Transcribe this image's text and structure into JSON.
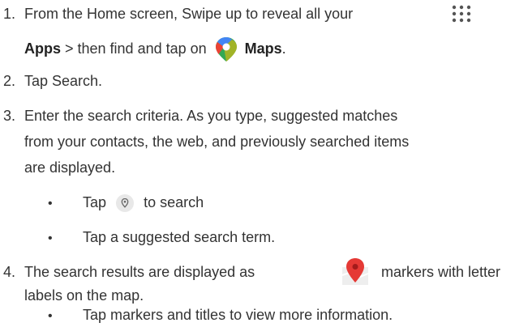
{
  "steps": [
    {
      "number": "1.",
      "line1": "From the Home screen, Swipe up to reveal all your",
      "apps_label": "Apps",
      "sep": " > then find and tap on ",
      "maps_label": "Maps",
      "end": "."
    },
    {
      "number": "2.",
      "text": "Tap Search."
    },
    {
      "number": "3.",
      "line1": "Enter the search criteria. As you type, suggested matches",
      "line2": "from your contacts, the web, and previously searched items",
      "line3": "are displayed."
    },
    {
      "number": "4.",
      "line1_a": "The search results are displayed as",
      "line1_b": "markers with letter",
      "line2": "labels on the map."
    }
  ],
  "step3_bullets": [
    {
      "before": "Tap",
      "after": "to search"
    },
    {
      "text": "Tap a suggested search term."
    }
  ],
  "step4_bullets": [
    {
      "text": "Tap markers and titles to view more information."
    }
  ],
  "bullet_char": "•",
  "icons": {
    "apps": "app-grid-icon",
    "maps": "google-maps-icon",
    "search": "location-search-icon",
    "marker": "map-marker-icon"
  },
  "colors": {
    "text": "#333333",
    "maps_green": "#34a853",
    "maps_blue": "#4285f4",
    "maps_red": "#ea4335",
    "maps_yellow": "#fbbc04"
  }
}
